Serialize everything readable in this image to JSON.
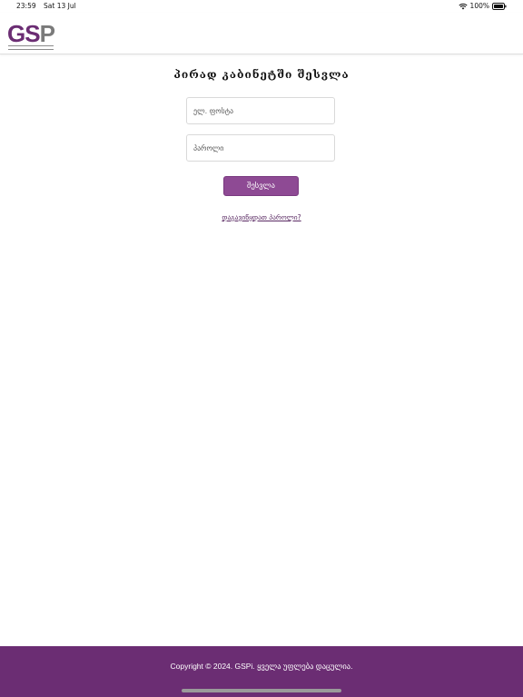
{
  "status_bar": {
    "time": "23:59",
    "date": "Sat 13 Jul",
    "battery_percent": "100%",
    "icons": [
      "wifi-icon",
      "battery-icon"
    ]
  },
  "header": {
    "logo_text_g": "G",
    "logo_text_s": "S",
    "logo_text_p": "P"
  },
  "login": {
    "title": "პირად კაბინეტში შესვლა",
    "email_placeholder": "ელ. ფოსტა",
    "password_placeholder": "პაროლი",
    "submit_label": "შესვლა",
    "forgot_password": "დაგავიწყდათ პაროლი?"
  },
  "footer": {
    "copyright": "Copyright © 2024. GSPi. ყველა უფლება დაცულია."
  },
  "colors": {
    "brand": "#6b2d73",
    "button": "#8e4a94",
    "link": "#5a2a63"
  }
}
